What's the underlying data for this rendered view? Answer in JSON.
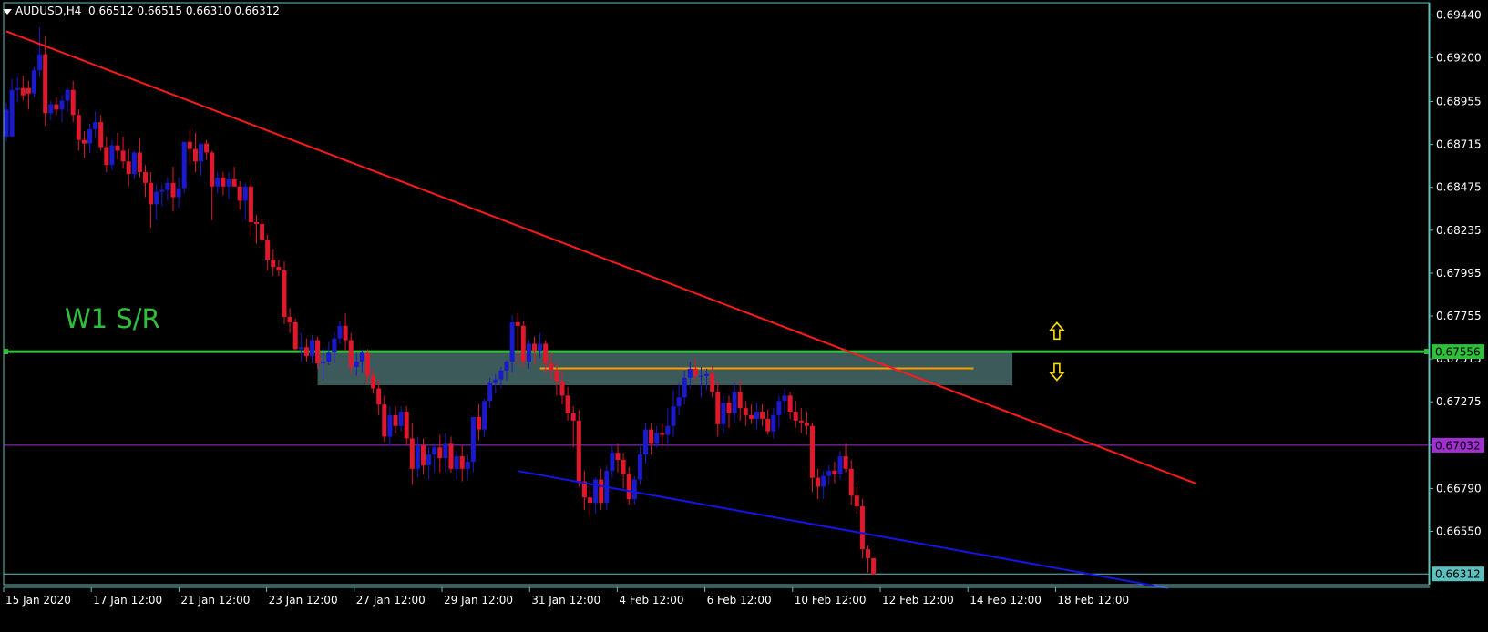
{
  "header": {
    "symbol": "AUDUSD,H4",
    "ohlc": "0.66512 0.66515 0.66310 0.66312"
  },
  "annotations": {
    "sr_label": "W1 S/R"
  },
  "colors": {
    "background": "#000000",
    "frame": "#5fbfbf",
    "bull": "#1a1acc",
    "bear": "#e0182c",
    "trend_down": "#ff1a1a",
    "trend_support": "#1414e6",
    "sr_line": "#2fbf3a",
    "zone": "#3d5a5a",
    "mid_line": "#a030d0",
    "orange_line": "#ff9900",
    "arrow": "#ffe100",
    "axis_text": "#ffffff"
  },
  "chart_data": {
    "type": "candlestick",
    "title": "AUDUSD,H4",
    "x_tick_labels": [
      "15 Jan 2020",
      "17 Jan 12:00",
      "21 Jan 12:00",
      "23 Jan 12:00",
      "27 Jan 12:00",
      "29 Jan 12:00",
      "31 Jan 12:00",
      "4 Feb 12:00",
      "6 Feb 12:00",
      "10 Feb 12:00",
      "12 Feb 12:00",
      "14 Feb 12:00",
      "18 Feb 12:00"
    ],
    "y_tick_labels": [
      "0.69440",
      "0.69200",
      "0.68955",
      "0.68715",
      "0.68475",
      "0.68235",
      "0.67995",
      "0.67755",
      "0.67515",
      "0.67275",
      "0.67032",
      "0.66790",
      "0.66550"
    ],
    "ylim": [
      0.66252,
      0.69508
    ],
    "price_tags": [
      {
        "value": "0.67556",
        "color": "#2fbf3a"
      },
      {
        "value": "0.67032",
        "color": "#a030d0"
      },
      {
        "value": "0.66312",
        "color": "#5fbfbf"
      }
    ],
    "horizontal_levels": [
      {
        "name": "w1-sr-line",
        "y": 0.67556
      },
      {
        "name": "mid-line",
        "y": 0.67032
      },
      {
        "name": "current-price-line",
        "y": 0.66312
      }
    ],
    "orange_segment": {
      "x_start": 96,
      "x_end": 174,
      "y": 0.67462
    },
    "zone": {
      "x_start": 56,
      "x_end": 181,
      "y_top": 0.67562,
      "y_bottom": 0.67368
    },
    "trendlines": [
      {
        "name": "downtrend-line",
        "x1": 0,
        "y1": 0.69348,
        "x2": 214,
        "y2": 0.66818
      },
      {
        "name": "support-line",
        "x1": 92,
        "y1": 0.66888,
        "x2": 209,
        "y2": 0.66232
      }
    ],
    "arrows": [
      {
        "name": "up-arrow",
        "x": 189,
        "y": 0.67672
      },
      {
        "name": "down-arrow",
        "y": 0.67442,
        "x": 189
      }
    ],
    "x_tick_positions": [
      0,
      15,
      30,
      45,
      60,
      75,
      90,
      105,
      120,
      135,
      150,
      165,
      180
    ],
    "candles": [
      [
        0.6876,
        0.6895,
        0.6873,
        0.6891
      ],
      [
        0.6876,
        0.6908,
        0.6876,
        0.6902
      ],
      [
        0.6902,
        0.6909,
        0.6895,
        0.6903
      ],
      [
        0.6903,
        0.691,
        0.6896,
        0.6899
      ],
      [
        0.6903,
        0.6907,
        0.6891,
        0.69
      ],
      [
        0.69,
        0.6915,
        0.6898,
        0.6913
      ],
      [
        0.6913,
        0.6937,
        0.6909,
        0.6922
      ],
      [
        0.6922,
        0.6932,
        0.6882,
        0.6889
      ],
      [
        0.6889,
        0.6896,
        0.6885,
        0.6894
      ],
      [
        0.6894,
        0.6898,
        0.6888,
        0.6891
      ],
      [
        0.6891,
        0.6899,
        0.6884,
        0.6896
      ],
      [
        0.6896,
        0.6903,
        0.689,
        0.6902
      ],
      [
        0.6902,
        0.6907,
        0.6884,
        0.6888
      ],
      [
        0.6888,
        0.6891,
        0.6868,
        0.6874
      ],
      [
        0.6874,
        0.6879,
        0.6864,
        0.6872
      ],
      [
        0.6872,
        0.6883,
        0.6867,
        0.688
      ],
      [
        0.688,
        0.689,
        0.6875,
        0.6884
      ],
      [
        0.6884,
        0.6888,
        0.6868,
        0.687
      ],
      [
        0.687,
        0.6876,
        0.6856,
        0.686
      ],
      [
        0.686,
        0.6874,
        0.6857,
        0.6871
      ],
      [
        0.6871,
        0.6878,
        0.6863,
        0.6868
      ],
      [
        0.6868,
        0.6876,
        0.6858,
        0.6862
      ],
      [
        0.6862,
        0.6869,
        0.6848,
        0.6855
      ],
      [
        0.6855,
        0.6868,
        0.6852,
        0.6867
      ],
      [
        0.6867,
        0.6875,
        0.6853,
        0.6856
      ],
      [
        0.6856,
        0.686,
        0.6842,
        0.685
      ],
      [
        0.685,
        0.6856,
        0.6825,
        0.6838
      ],
      [
        0.6838,
        0.6849,
        0.6829,
        0.6845
      ],
      [
        0.6845,
        0.6849,
        0.6837,
        0.6846
      ],
      [
        0.6846,
        0.6853,
        0.684,
        0.685
      ],
      [
        0.685,
        0.6859,
        0.6834,
        0.6842
      ],
      [
        0.6842,
        0.6853,
        0.6836,
        0.6847
      ],
      [
        0.6847,
        0.6867,
        0.6844,
        0.6873
      ],
      [
        0.6873,
        0.688,
        0.686,
        0.6869
      ],
      [
        0.6869,
        0.6878,
        0.6856,
        0.6862
      ],
      [
        0.6862,
        0.6872,
        0.6854,
        0.6872
      ],
      [
        0.6872,
        0.6874,
        0.6863,
        0.6867
      ],
      [
        0.6867,
        0.6868,
        0.6829,
        0.6848
      ],
      [
        0.6848,
        0.6856,
        0.6844,
        0.6853
      ],
      [
        0.6853,
        0.6856,
        0.6843,
        0.6848
      ],
      [
        0.6848,
        0.6856,
        0.6841,
        0.6852
      ],
      [
        0.6852,
        0.6859,
        0.6848,
        0.6848
      ],
      [
        0.6848,
        0.6851,
        0.6835,
        0.684
      ],
      [
        0.684,
        0.685,
        0.6829,
        0.6848
      ],
      [
        0.6848,
        0.6852,
        0.682,
        0.6828
      ],
      [
        0.6828,
        0.6832,
        0.6816,
        0.6827
      ],
      [
        0.6827,
        0.683,
        0.6817,
        0.6818
      ],
      [
        0.6818,
        0.6821,
        0.6801,
        0.6807
      ],
      [
        0.6807,
        0.6813,
        0.6798,
        0.6803
      ],
      [
        0.6803,
        0.6807,
        0.6798,
        0.6801
      ],
      [
        0.6801,
        0.6806,
        0.6771,
        0.6775
      ],
      [
        0.6775,
        0.678,
        0.6766,
        0.6772
      ],
      [
        0.6772,
        0.6774,
        0.6756,
        0.6757
      ],
      [
        0.6757,
        0.6766,
        0.675,
        0.6758
      ],
      [
        0.6758,
        0.6763,
        0.675,
        0.6753
      ],
      [
        0.6753,
        0.6765,
        0.6749,
        0.6762
      ],
      [
        0.6762,
        0.6764,
        0.6746,
        0.6749
      ],
      [
        0.6749,
        0.6758,
        0.674,
        0.675
      ],
      [
        0.675,
        0.6761,
        0.6748,
        0.6755
      ],
      [
        0.6755,
        0.6766,
        0.6749,
        0.6763
      ],
      [
        0.6763,
        0.6773,
        0.676,
        0.677
      ],
      [
        0.677,
        0.6777,
        0.6756,
        0.6762
      ],
      [
        0.6762,
        0.6766,
        0.6743,
        0.6747
      ],
      [
        0.6747,
        0.6755,
        0.6742,
        0.675
      ],
      [
        0.675,
        0.6757,
        0.6744,
        0.6755
      ],
      [
        0.6755,
        0.6757,
        0.6738,
        0.6742
      ],
      [
        0.6742,
        0.6746,
        0.6732,
        0.6735
      ],
      [
        0.6735,
        0.674,
        0.672,
        0.6726
      ],
      [
        0.6726,
        0.6731,
        0.6705,
        0.6708
      ],
      [
        0.6708,
        0.6725,
        0.6703,
        0.672
      ],
      [
        0.672,
        0.6725,
        0.671,
        0.6714
      ],
      [
        0.6714,
        0.6725,
        0.6711,
        0.6722
      ],
      [
        0.6722,
        0.6725,
        0.6703,
        0.6707
      ],
      [
        0.6707,
        0.6716,
        0.6681,
        0.669
      ],
      [
        0.669,
        0.6708,
        0.6685,
        0.6703
      ],
      [
        0.6703,
        0.6707,
        0.6687,
        0.6692
      ],
      [
        0.6692,
        0.6702,
        0.6684,
        0.6698
      ],
      [
        0.6698,
        0.6704,
        0.6688,
        0.6702
      ],
      [
        0.6702,
        0.6709,
        0.6688,
        0.6696
      ],
      [
        0.6696,
        0.671,
        0.6688,
        0.6704
      ],
      [
        0.6704,
        0.6708,
        0.6688,
        0.669
      ],
      [
        0.669,
        0.67,
        0.6684,
        0.6697
      ],
      [
        0.6697,
        0.6703,
        0.6683,
        0.669
      ],
      [
        0.669,
        0.6698,
        0.6684,
        0.6694
      ],
      [
        0.6694,
        0.6719,
        0.6688,
        0.6719
      ],
      [
        0.6719,
        0.6726,
        0.6706,
        0.6712
      ],
      [
        0.6712,
        0.6729,
        0.6708,
        0.6728
      ],
      [
        0.6728,
        0.6741,
        0.6724,
        0.6738
      ],
      [
        0.6738,
        0.6743,
        0.6732,
        0.674
      ],
      [
        0.674,
        0.6747,
        0.6735,
        0.6745
      ],
      [
        0.6745,
        0.6751,
        0.6739,
        0.675
      ],
      [
        0.675,
        0.6776,
        0.6744,
        0.6772
      ],
      [
        0.6772,
        0.6777,
        0.6748,
        0.677
      ],
      [
        0.677,
        0.6773,
        0.6747,
        0.675
      ],
      [
        0.675,
        0.6762,
        0.6746,
        0.676
      ],
      [
        0.676,
        0.6764,
        0.6748,
        0.6756
      ],
      [
        0.6756,
        0.6766,
        0.6752,
        0.676
      ],
      [
        0.676,
        0.6762,
        0.6743,
        0.6749
      ],
      [
        0.6749,
        0.6755,
        0.674,
        0.6745
      ],
      [
        0.6745,
        0.675,
        0.6731,
        0.6739
      ],
      [
        0.6739,
        0.6745,
        0.6726,
        0.6731
      ],
      [
        0.6731,
        0.6736,
        0.6717,
        0.6721
      ],
      [
        0.6721,
        0.6725,
        0.6702,
        0.6717
      ],
      [
        0.6717,
        0.6723,
        0.668,
        0.6683
      ],
      [
        0.6683,
        0.6689,
        0.6667,
        0.6674
      ],
      [
        0.6674,
        0.668,
        0.6663,
        0.6671
      ],
      [
        0.6671,
        0.6685,
        0.6665,
        0.6684
      ],
      [
        0.6684,
        0.669,
        0.6667,
        0.6671
      ],
      [
        0.6671,
        0.6692,
        0.6667,
        0.6689
      ],
      [
        0.6689,
        0.6703,
        0.6685,
        0.6699
      ],
      [
        0.6699,
        0.6704,
        0.6688,
        0.6695
      ],
      [
        0.6695,
        0.6699,
        0.6679,
        0.6687
      ],
      [
        0.6687,
        0.6691,
        0.667,
        0.6673
      ],
      [
        0.6673,
        0.6686,
        0.667,
        0.6684
      ],
      [
        0.6684,
        0.6704,
        0.6681,
        0.6698
      ],
      [
        0.6698,
        0.6716,
        0.6693,
        0.6712
      ],
      [
        0.6712,
        0.6716,
        0.6698,
        0.6704
      ],
      [
        0.6704,
        0.6714,
        0.6702,
        0.671
      ],
      [
        0.671,
        0.6715,
        0.6703,
        0.6709
      ],
      [
        0.6709,
        0.6724,
        0.6704,
        0.6714
      ],
      [
        0.6714,
        0.6734,
        0.6708,
        0.6725
      ],
      [
        0.6725,
        0.6738,
        0.672,
        0.673
      ],
      [
        0.673,
        0.6745,
        0.6726,
        0.6741
      ],
      [
        0.6741,
        0.675,
        0.6735,
        0.6746
      ],
      [
        0.6746,
        0.6752,
        0.6739,
        0.6742
      ],
      [
        0.6742,
        0.6747,
        0.673,
        0.6742
      ],
      [
        0.6742,
        0.6746,
        0.6734,
        0.6743
      ],
      [
        0.6743,
        0.6747,
        0.673,
        0.6733
      ],
      [
        0.6733,
        0.6739,
        0.6708,
        0.6715
      ],
      [
        0.6715,
        0.6731,
        0.671,
        0.6727
      ],
      [
        0.6727,
        0.6731,
        0.6713,
        0.6721
      ],
      [
        0.6721,
        0.6738,
        0.6716,
        0.6733
      ],
      [
        0.6733,
        0.674,
        0.6717,
        0.6724
      ],
      [
        0.6724,
        0.6728,
        0.6714,
        0.672
      ],
      [
        0.672,
        0.6726,
        0.6715,
        0.6718
      ],
      [
        0.6718,
        0.6727,
        0.6712,
        0.6722
      ],
      [
        0.6722,
        0.6726,
        0.6714,
        0.6718
      ],
      [
        0.6718,
        0.6723,
        0.6709,
        0.6711
      ],
      [
        0.6711,
        0.6724,
        0.6707,
        0.672
      ],
      [
        0.672,
        0.6731,
        0.6713,
        0.6728
      ],
      [
        0.6728,
        0.6735,
        0.6721,
        0.6731
      ],
      [
        0.6731,
        0.6733,
        0.6718,
        0.6722
      ],
      [
        0.6722,
        0.6728,
        0.6713,
        0.6717
      ],
      [
        0.6717,
        0.6724,
        0.671,
        0.6716
      ],
      [
        0.6716,
        0.6722,
        0.6709,
        0.6714
      ],
      [
        0.6714,
        0.6716,
        0.6677,
        0.6685
      ],
      [
        0.6685,
        0.669,
        0.6673,
        0.668
      ],
      [
        0.668,
        0.6689,
        0.6673,
        0.6686
      ],
      [
        0.6686,
        0.6692,
        0.6681,
        0.6689
      ],
      [
        0.6689,
        0.6694,
        0.6682,
        0.6687
      ],
      [
        0.6687,
        0.67,
        0.6684,
        0.6697
      ],
      [
        0.6697,
        0.6704,
        0.6688,
        0.669
      ],
      [
        0.669,
        0.6695,
        0.667,
        0.6675
      ],
      [
        0.6675,
        0.668,
        0.6665,
        0.6669
      ],
      [
        0.6669,
        0.6673,
        0.664,
        0.6645
      ],
      [
        0.6645,
        0.6647,
        0.6632,
        0.664
      ],
      [
        0.664,
        0.664,
        0.6631,
        0.6631
      ]
    ]
  }
}
